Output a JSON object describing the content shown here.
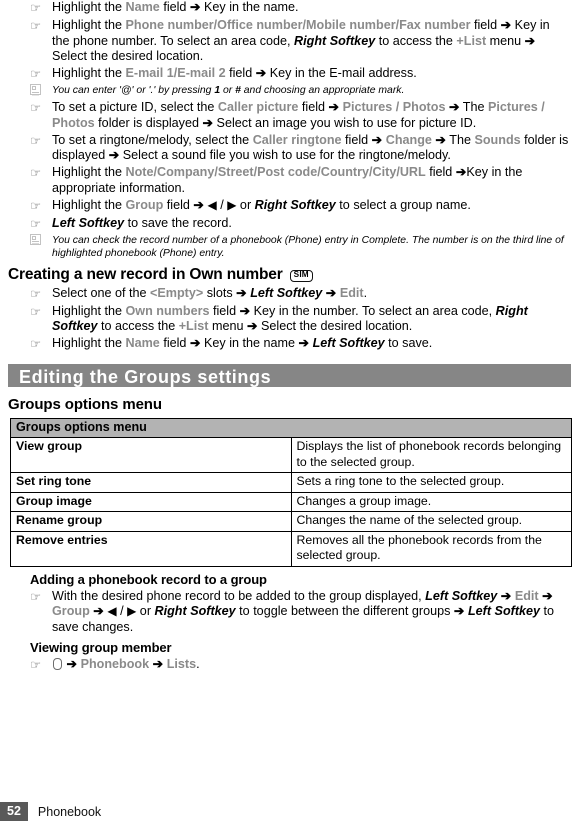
{
  "document": {
    "footer": {
      "page_number": "52",
      "section": "Phonebook"
    }
  },
  "icons": {
    "hand_bullet": "hand-pointing-icon",
    "memo": "memo-note-icon",
    "ok_key": "ok-key-icon",
    "sim_badge": "SIM"
  },
  "steps_phonebook": [
    {
      "id": "step-name-field",
      "parts": [
        {
          "t": "Highlight the ",
          "s": "plain"
        },
        {
          "t": "Name",
          "s": "ui"
        },
        {
          "t": " field ",
          "s": "plain"
        },
        {
          "t": "➔",
          "s": "arrow"
        },
        {
          "t": " Key in the name.",
          "s": "plain"
        }
      ]
    },
    {
      "id": "step-phone-number-field",
      "parts": [
        {
          "t": "Highlight the ",
          "s": "plain"
        },
        {
          "t": "Phone number/Office number/Mobile number/Fax number",
          "s": "ui"
        },
        {
          "t": " field ",
          "s": "plain"
        },
        {
          "t": "➔",
          "s": "arrow"
        },
        {
          "t": " Key in the phone number. To select an area code, ",
          "s": "plain"
        },
        {
          "t": "Right Softkey",
          "s": "bolditalic"
        },
        {
          "t": " to access the ",
          "s": "plain"
        },
        {
          "t": "+List",
          "s": "ui"
        },
        {
          "t": " menu ",
          "s": "plain"
        },
        {
          "t": "➔",
          "s": "arrow"
        },
        {
          "t": " Select the desired location.",
          "s": "plain"
        }
      ]
    },
    {
      "id": "step-email-field",
      "parts": [
        {
          "t": "Highlight the ",
          "s": "plain"
        },
        {
          "t": "E-mail 1/E-mail 2",
          "s": "ui"
        },
        {
          "t": " field ",
          "s": "plain"
        },
        {
          "t": "➔",
          "s": "arrow"
        },
        {
          "t": " Key in the E-mail address.",
          "s": "plain"
        }
      ]
    }
  ],
  "note_email": {
    "id": "note-email-symbols",
    "parts": [
      {
        "t": "You can enter '@' or '.' by pressing ",
        "s": "plain"
      },
      {
        "t": "1",
        "s": "bold"
      },
      {
        "t": " or ",
        "s": "plain"
      },
      {
        "t": "#",
        "s": "bold"
      },
      {
        "t": " and choosing an appropriate mark.",
        "s": "plain"
      }
    ]
  },
  "steps_phonebook2": [
    {
      "id": "step-picture-id",
      "parts": [
        {
          "t": "To set a picture ID, select the ",
          "s": "plain"
        },
        {
          "t": "Caller picture",
          "s": "ui"
        },
        {
          "t": " field ",
          "s": "plain"
        },
        {
          "t": "➔",
          "s": "arrow"
        },
        {
          "t": " ",
          "s": "plain"
        },
        {
          "t": "Pictures / Photos",
          "s": "ui"
        },
        {
          "t": " ",
          "s": "plain"
        },
        {
          "t": "➔",
          "s": "arrow"
        },
        {
          "t": " The ",
          "s": "plain"
        },
        {
          "t": "Pictures / Photos",
          "s": "ui"
        },
        {
          "t": " folder is displayed ",
          "s": "plain"
        },
        {
          "t": "➔",
          "s": "arrow"
        },
        {
          "t": " Select an image you wish to use for picture ID.",
          "s": "plain"
        }
      ]
    },
    {
      "id": "step-ringtone",
      "parts": [
        {
          "t": "To set a ringtone/melody, select the ",
          "s": "plain"
        },
        {
          "t": "Caller ringtone",
          "s": "ui"
        },
        {
          "t": " field ",
          "s": "plain"
        },
        {
          "t": "➔",
          "s": "arrow"
        },
        {
          "t": " ",
          "s": "plain"
        },
        {
          "t": "Change",
          "s": "ui"
        },
        {
          "t": " ",
          "s": "plain"
        },
        {
          "t": "➔",
          "s": "arrow"
        },
        {
          "t": " The ",
          "s": "plain"
        },
        {
          "t": "Sounds",
          "s": "ui"
        },
        {
          "t": " folder is displayed ",
          "s": "plain"
        },
        {
          "t": "➔",
          "s": "arrow"
        },
        {
          "t": " Select a sound file you wish to use for the ringtone/melody.",
          "s": "plain"
        }
      ]
    },
    {
      "id": "step-note-company",
      "parts": [
        {
          "t": "Highlight the ",
          "s": "plain"
        },
        {
          "t": "Note/Company/Street/Post code/Country/City/URL",
          "s": "ui"
        },
        {
          "t": " field ",
          "s": "plain"
        },
        {
          "t": "➔",
          "s": "arrow"
        },
        {
          "t": "Key in the appropriate information.",
          "s": "plain"
        }
      ]
    },
    {
      "id": "step-group-field",
      "parts": [
        {
          "t": "Highlight the ",
          "s": "plain"
        },
        {
          "t": "Group",
          "s": "ui"
        },
        {
          "t": " field ",
          "s": "plain"
        },
        {
          "t": "➔",
          "s": "arrow"
        },
        {
          "t": " ",
          "s": "plain"
        },
        {
          "t": "◀",
          "s": "tri"
        },
        {
          "t": " / ",
          "s": "plain"
        },
        {
          "t": "▶",
          "s": "tri"
        },
        {
          "t": " or ",
          "s": "plain"
        },
        {
          "t": "Right Softkey",
          "s": "bolditalic"
        },
        {
          "t": " to select a group name.",
          "s": "plain"
        }
      ]
    },
    {
      "id": "step-save-record",
      "parts": [
        {
          "t": "Left Softkey",
          "s": "bolditalic"
        },
        {
          "t": " to save the record.",
          "s": "plain"
        }
      ]
    }
  ],
  "note_record_number": {
    "id": "note-record-number",
    "parts": [
      {
        "t": "You can check the record number of a phonebook (Phone) entry in Complete. The number is on the third line of highlighted phonebook (Phone) entry.",
        "s": "plain"
      }
    ]
  },
  "heading_own_number": {
    "id": "heading-creating-record-own-number",
    "text": "Creating a new record in Own number",
    "badge": "SIM"
  },
  "steps_own_number": [
    {
      "id": "step-empty-slot",
      "parts": [
        {
          "t": "Select one of the ",
          "s": "plain"
        },
        {
          "t": "<Empty>",
          "s": "ui"
        },
        {
          "t": " slots ",
          "s": "plain"
        },
        {
          "t": "➔",
          "s": "arrow"
        },
        {
          "t": " ",
          "s": "plain"
        },
        {
          "t": "Left Softkey",
          "s": "bolditalic"
        },
        {
          "t": " ",
          "s": "plain"
        },
        {
          "t": "➔",
          "s": "arrow"
        },
        {
          "t": " ",
          "s": "plain"
        },
        {
          "t": "Edit",
          "s": "ui"
        },
        {
          "t": ".",
          "s": "plain"
        }
      ]
    },
    {
      "id": "step-own-numbers-field",
      "parts": [
        {
          "t": "Highlight the ",
          "s": "plain"
        },
        {
          "t": "Own numbers",
          "s": "ui"
        },
        {
          "t": " field ",
          "s": "plain"
        },
        {
          "t": "➔",
          "s": "arrow"
        },
        {
          "t": " Key in the number. To select an area code, ",
          "s": "plain"
        },
        {
          "t": "Right Softkey",
          "s": "bolditalic"
        },
        {
          "t": " to access the ",
          "s": "plain"
        },
        {
          "t": "+List",
          "s": "ui"
        },
        {
          "t": " menu ",
          "s": "plain"
        },
        {
          "t": "➔",
          "s": "arrow"
        },
        {
          "t": " Select the desired location.",
          "s": "plain"
        }
      ]
    },
    {
      "id": "step-own-name-field",
      "parts": [
        {
          "t": "Highlight the ",
          "s": "plain"
        },
        {
          "t": "Name",
          "s": "ui"
        },
        {
          "t": " field ",
          "s": "plain"
        },
        {
          "t": "➔",
          "s": "arrow"
        },
        {
          "t": " Key in the name ",
          "s": "plain"
        },
        {
          "t": "➔",
          "s": "arrow"
        },
        {
          "t": " ",
          "s": "plain"
        },
        {
          "t": "Left Softkey",
          "s": "bolditalic"
        },
        {
          "t": " to save.",
          "s": "plain"
        }
      ]
    }
  ],
  "banner": {
    "id": "banner-editing-groups",
    "text": "Editing the Groups settings"
  },
  "groups_options_heading": "Groups options menu",
  "groups_table": {
    "header": "Groups options menu",
    "rows": [
      {
        "key": "View group",
        "desc": "Displays the list of phonebook records belonging to the selected group."
      },
      {
        "key": "Set ring tone",
        "desc": "Sets a ring tone to the selected group."
      },
      {
        "key": "Group image",
        "desc": "Changes a group image."
      },
      {
        "key": "Rename group",
        "desc": "Changes the name of the selected group."
      },
      {
        "key": "Remove entries",
        "desc": "Removes all the phonebook records from the selected group."
      }
    ]
  },
  "heading_adding_record": "Adding a phonebook record to a group",
  "steps_adding": [
    {
      "id": "step-add-record-to-group",
      "parts": [
        {
          "t": "With the desired phone record to be added to the group displayed, ",
          "s": "plain"
        },
        {
          "t": "Left Softkey",
          "s": "bolditalic"
        },
        {
          "t": " ",
          "s": "plain"
        },
        {
          "t": "➔",
          "s": "arrow"
        },
        {
          "t": " ",
          "s": "plain"
        },
        {
          "t": "Edit",
          "s": "ui"
        },
        {
          "t": " ",
          "s": "plain"
        },
        {
          "t": "➔",
          "s": "arrow"
        },
        {
          "t": " ",
          "s": "plain"
        },
        {
          "t": "Group",
          "s": "ui"
        },
        {
          "t": " ",
          "s": "plain"
        },
        {
          "t": "➔",
          "s": "arrow"
        },
        {
          "t": " ",
          "s": "plain"
        },
        {
          "t": "◀",
          "s": "tri"
        },
        {
          "t": " / ",
          "s": "plain"
        },
        {
          "t": "▶",
          "s": "tri"
        },
        {
          "t": " or ",
          "s": "plain"
        },
        {
          "t": "Right Softkey",
          "s": "bolditalic"
        },
        {
          "t": " to toggle between the different groups ",
          "s": "plain"
        },
        {
          "t": "➔",
          "s": "arrow"
        },
        {
          "t": " ",
          "s": "plain"
        },
        {
          "t": "Left Softkey",
          "s": "bolditalic"
        },
        {
          "t": " to save changes.",
          "s": "plain"
        }
      ]
    }
  ],
  "heading_viewing_group": "Viewing group member",
  "steps_viewing": [
    {
      "id": "step-view-group-member",
      "parts": [
        {
          "t": "okkey",
          "s": "okkey"
        },
        {
          "t": " ",
          "s": "plain"
        },
        {
          "t": "➔",
          "s": "arrow"
        },
        {
          "t": " ",
          "s": "plain"
        },
        {
          "t": "Phonebook",
          "s": "ui"
        },
        {
          "t": " ",
          "s": "plain"
        },
        {
          "t": "➔",
          "s": "arrow"
        },
        {
          "t": " ",
          "s": "plain"
        },
        {
          "t": "Lists",
          "s": "ui"
        },
        {
          "t": ".",
          "s": "plain"
        }
      ]
    }
  ]
}
